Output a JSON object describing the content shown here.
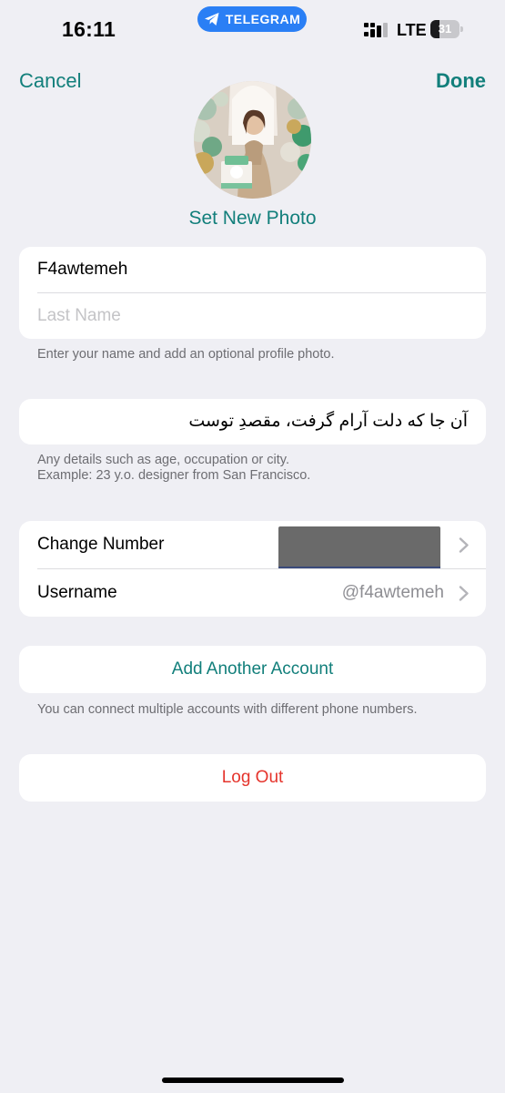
{
  "status_bar": {
    "time": "16:11",
    "live_activity": "TELEGRAM",
    "network": "LTE",
    "battery_level": "31",
    "battery_fraction": 0.31
  },
  "nav": {
    "cancel_label": "Cancel",
    "done_label": "Done"
  },
  "profile": {
    "set_photo_label": "Set New Photo"
  },
  "name_section": {
    "first_name": "F4awtemeh",
    "last_name_placeholder": "Last Name",
    "footnote": "Enter your name and add an optional profile photo."
  },
  "bio_section": {
    "bio": "آن جا که دلت آرام گرفت، مقصدِ توست",
    "footnote_line1": "Any details such as age, occupation or city.",
    "footnote_line2": "Example: 23 y.o. designer from San Francisco."
  },
  "account_section": {
    "change_number_label": "Change Number",
    "username_label": "Username",
    "username_value": "@f4awtemeh"
  },
  "add_account_section": {
    "label": "Add Another Account",
    "footnote": "You can connect multiple accounts with different phone numbers."
  },
  "logout_section": {
    "label": "Log Out"
  },
  "colors": {
    "accent": "#127f7b",
    "destructive": "#e5342c",
    "background": "#efeff4",
    "telegram_pill": "#2a7ff5"
  }
}
